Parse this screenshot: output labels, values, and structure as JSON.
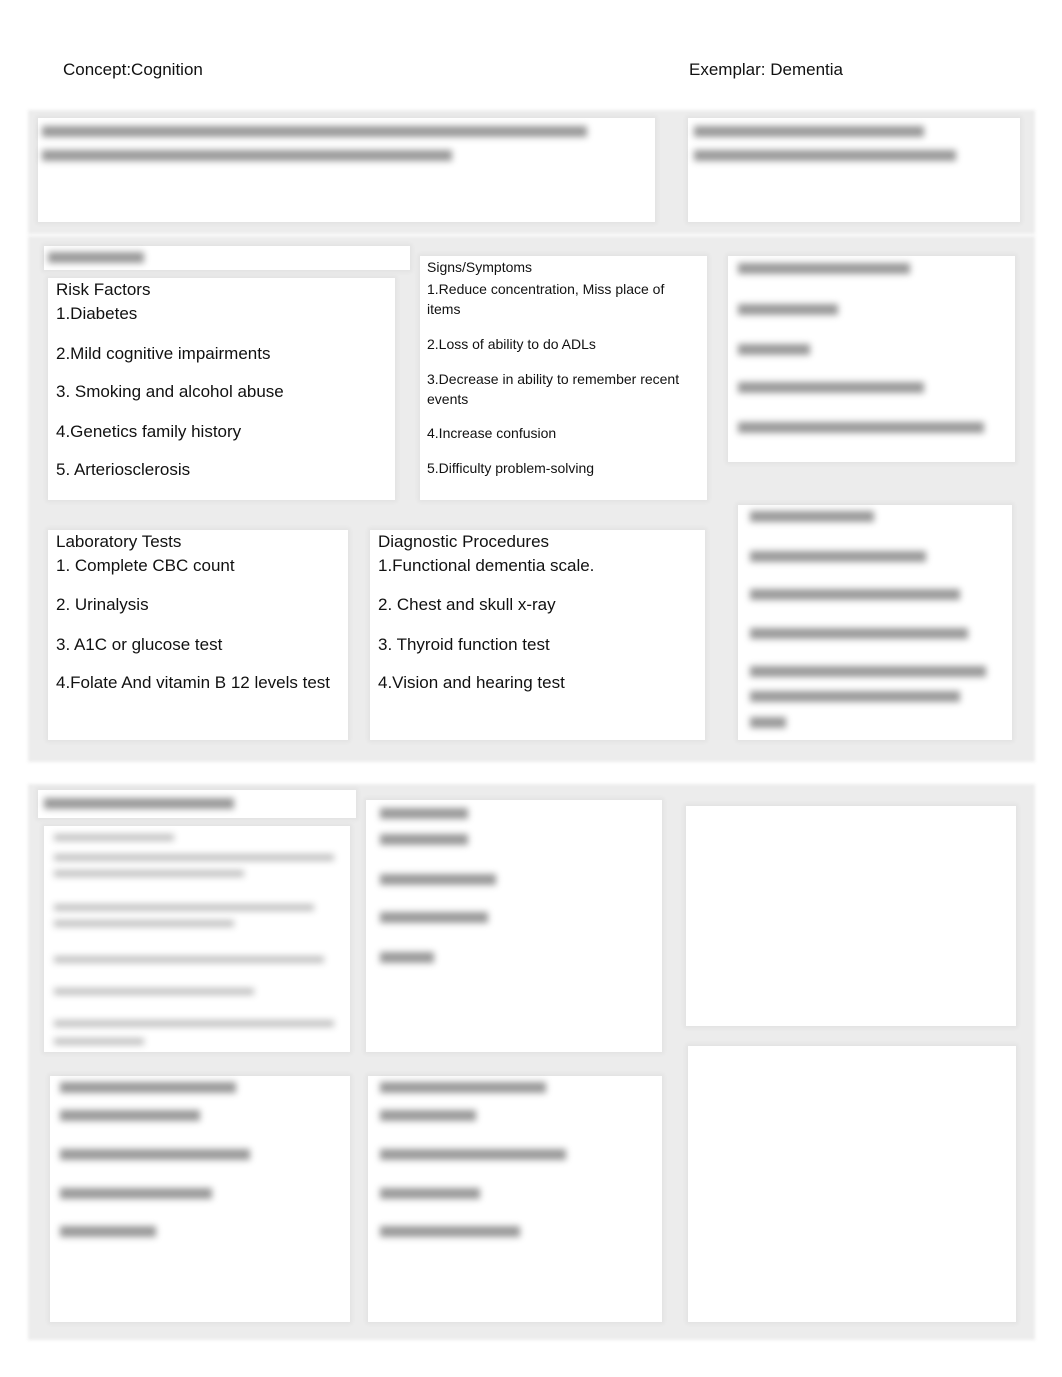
{
  "header": {
    "concept": "Concept:Cognition",
    "exemplar": "Exemplar: Dementia"
  },
  "risk_factors": {
    "title": "Risk Factors",
    "items": [
      "1.Diabetes",
      "2.Mild cognitive impairments",
      "3. Smoking and alcohol abuse",
      "4.Genetics family history",
      "5. Arteriosclerosis"
    ]
  },
  "signs_symptoms": {
    "title": "Signs/Symptoms",
    "items": [
      "1.Reduce concentration, Miss place of items",
      "2.Loss of ability to do ADLs",
      "3.Decrease in ability to remember recent events",
      "4.Increase confusion",
      "5.Difficulty problem-solving"
    ]
  },
  "laboratory_tests": {
    "title": "Laboratory Tests",
    "items": [
      "1. Complete CBC count",
      "2. Urinalysis",
      "3. A1C or glucose test",
      "4.Folate And vitamin B 12 levels test"
    ]
  },
  "diagnostic_procedures": {
    "title": "Diagnostic Procedures",
    "items": [
      "1.Functional dementia scale.",
      "2. Chest and skull x-ray",
      "3. Thyroid function test",
      "4.Vision and hearing test"
    ]
  }
}
